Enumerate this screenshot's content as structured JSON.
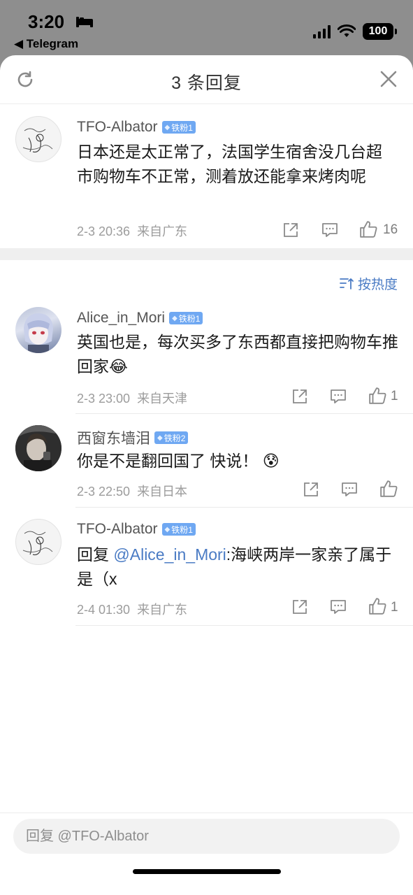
{
  "status_bar": {
    "time": "3:20",
    "back_app": "◀ Telegram",
    "battery": "100"
  },
  "header": {
    "title": "3 条回复"
  },
  "root_comment": {
    "username": "TFO-Albator",
    "badge": "铁粉1",
    "text": "日本还是太正常了，法国学生宿舍没几台超市购物车不正常，测着放还能拿来烤肉呢",
    "date": "2-3 20:36",
    "location": "来自广东",
    "likes": "16"
  },
  "sort_label": "按热度",
  "replies": [
    {
      "username": "Alice_in_Mori",
      "badge": "铁粉1",
      "text": "英国也是，每次买多了东西都直接把购物车推回家",
      "emoji": "😂",
      "date": "2-3 23:00",
      "location": "来自天津",
      "likes": "1"
    },
    {
      "username": "西窗东墙泪",
      "badge": "铁粉2",
      "text": "你是不是翻回国了 快说！",
      "emoji": "😰",
      "date": "2-3 22:50",
      "location": "来自日本",
      "likes": ""
    },
    {
      "username": "TFO-Albator",
      "badge": "铁粉1",
      "reply_prefix": "回复 ",
      "mention": "@Alice_in_Mori",
      "text": ":海峡两岸一家亲了属于是（x",
      "date": "2-4 01:30",
      "location": "来自广东",
      "likes": "1"
    }
  ],
  "input": {
    "placeholder": "回复 @TFO-Albator"
  }
}
